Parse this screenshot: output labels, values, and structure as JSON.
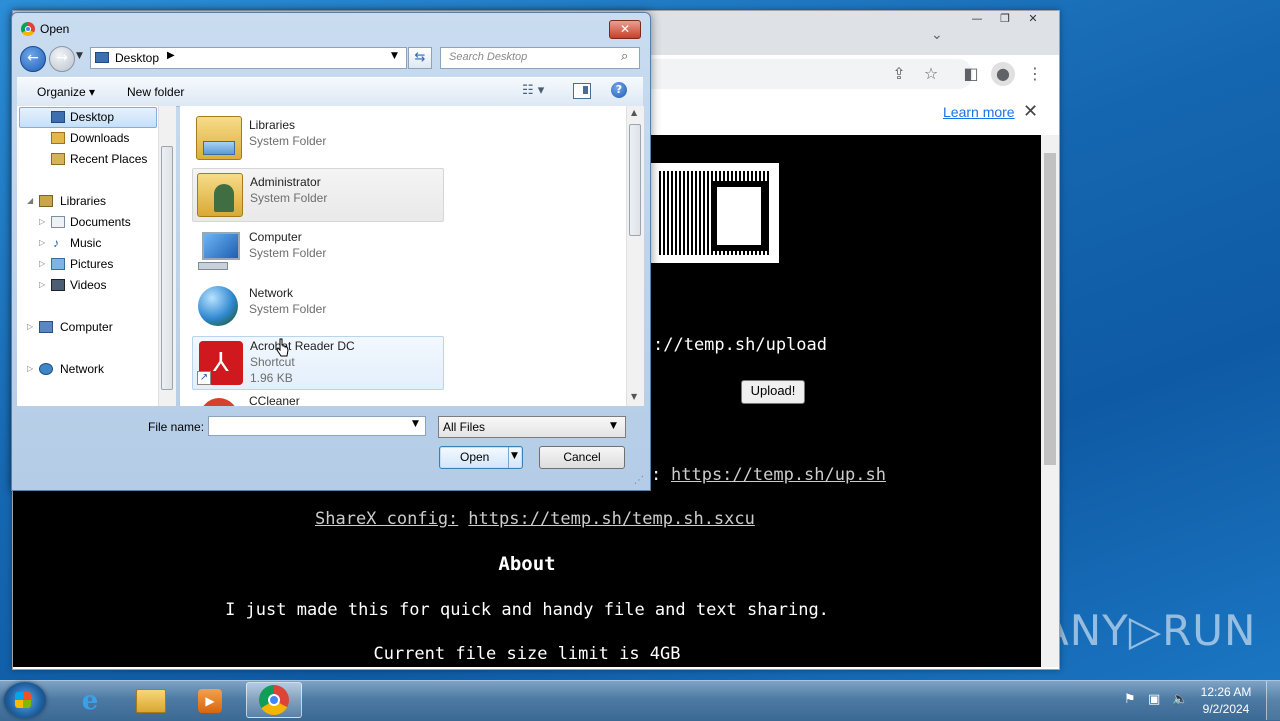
{
  "desktop": {
    "watermark": "ANY▷RUN"
  },
  "chrome": {
    "learn_more": "Learn more",
    "page": {
      "upload_url": "://temp.sh/upload",
      "upload_button": "Upload!",
      "upsh_prefix": ":",
      "upsh_link": "https://temp.sh/up.sh",
      "sharex_label": "ShareX config:",
      "sharex_link": "https://temp.sh/temp.sh.sxcu",
      "about_heading": "About",
      "about_text": "I just made this for quick and handy file and text sharing.",
      "limit_text": "Current file size limit is 4GB"
    }
  },
  "dialog": {
    "title": "Open",
    "address": {
      "location": "Desktop"
    },
    "search_placeholder": "Search Desktop",
    "toolbar": {
      "organize": "Organize ▾",
      "new_folder": "New folder"
    },
    "nav_pane": {
      "items": [
        {
          "label": "Desktop",
          "icon": "desktop-icon"
        },
        {
          "label": "Downloads",
          "icon": "downloads-icon"
        },
        {
          "label": "Recent Places",
          "icon": "recent-places-icon"
        },
        {
          "label": "Libraries",
          "icon": "libraries-icon"
        },
        {
          "label": "Documents",
          "icon": "documents-icon"
        },
        {
          "label": "Music",
          "icon": "music-icon"
        },
        {
          "label": "Pictures",
          "icon": "pictures-icon"
        },
        {
          "label": "Videos",
          "icon": "videos-icon"
        },
        {
          "label": "Computer",
          "icon": "computer-icon"
        },
        {
          "label": "Network",
          "icon": "network-icon"
        }
      ]
    },
    "files": [
      {
        "name": "Libraries",
        "type": "System Folder",
        "size": ""
      },
      {
        "name": "Administrator",
        "type": "System Folder",
        "size": ""
      },
      {
        "name": "Computer",
        "type": "System Folder",
        "size": ""
      },
      {
        "name": "Network",
        "type": "System Folder",
        "size": ""
      },
      {
        "name": "Acrobat Reader DC",
        "type": "Shortcut",
        "size": "1.96 KB"
      },
      {
        "name": "CCleaner",
        "type": "",
        "size": ""
      }
    ],
    "filename_label": "File name:",
    "filename_value": "",
    "filetype_value": "All Files",
    "open_button": "Open",
    "cancel_button": "Cancel"
  },
  "taskbar": {
    "clock_time": "12:26 AM",
    "clock_date": "9/2/2024"
  }
}
